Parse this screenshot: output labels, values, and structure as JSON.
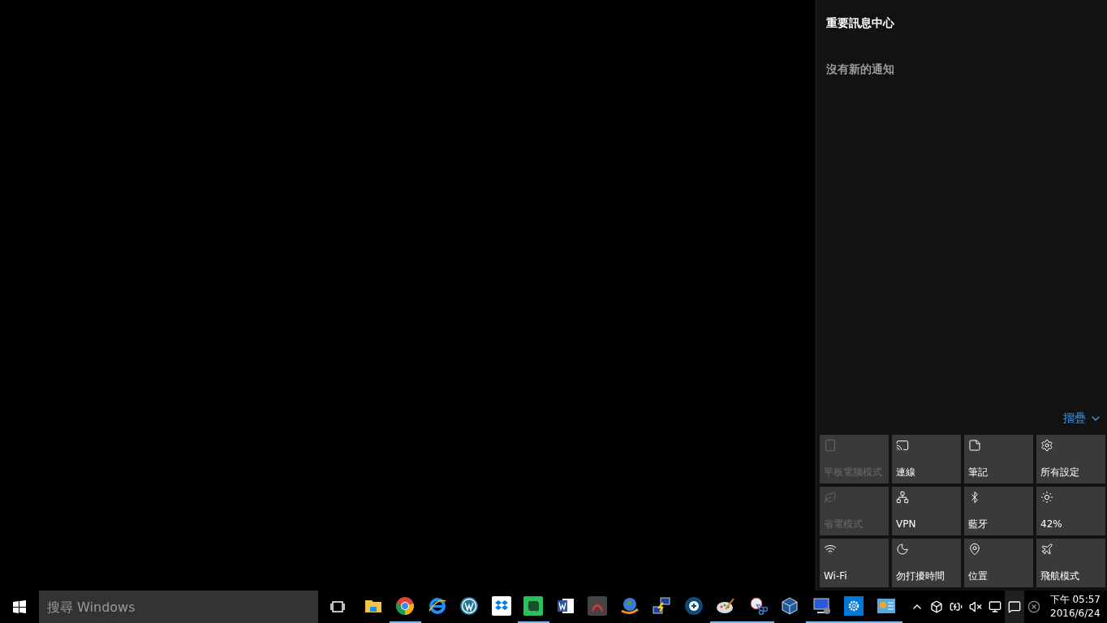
{
  "action_center": {
    "title": "重要訊息中心",
    "empty_message": "沒有新的通知",
    "collapse_link": "摺疊",
    "quick_actions": [
      {
        "label": "平板電腦模式",
        "disabled": true
      },
      {
        "label": "連線",
        "disabled": false
      },
      {
        "label": "筆記",
        "disabled": false
      },
      {
        "label": "所有設定",
        "disabled": false
      },
      {
        "label": "省電模式",
        "disabled": true
      },
      {
        "label": "VPN",
        "disabled": false
      },
      {
        "label": "藍牙",
        "disabled": false
      },
      {
        "label": "42%",
        "disabled": false
      },
      {
        "label": "Wi-Fi",
        "disabled": false
      },
      {
        "label": "勿打擾時間",
        "disabled": false
      },
      {
        "label": "位置",
        "disabled": false
      },
      {
        "label": "飛航模式",
        "disabled": false
      }
    ]
  },
  "taskbar": {
    "search": {
      "placeholder": "搜尋 Windows"
    },
    "apps": [
      {
        "running": false
      },
      {
        "running": true
      },
      {
        "running": false
      },
      {
        "running": false
      },
      {
        "running": false
      },
      {
        "running": true
      },
      {
        "running": false
      },
      {
        "running": false
      },
      {
        "running": false
      },
      {
        "running": false
      },
      {
        "running": false
      },
      {
        "running": true
      },
      {
        "running": true
      },
      {
        "running": false
      },
      {
        "running": true
      },
      {
        "running": true
      },
      {
        "running": true
      }
    ],
    "clock": {
      "time": "下午 05:57",
      "date": "2016/6/24"
    }
  }
}
